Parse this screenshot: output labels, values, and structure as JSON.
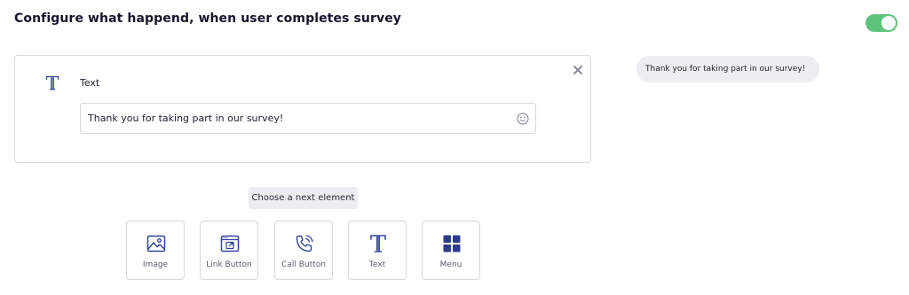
{
  "header": {
    "title": "Configure what happend, when user completes survey",
    "toggle_on": true,
    "toggle_color": "#5ec47d"
  },
  "text_element": {
    "icon": "text-type-icon",
    "label": "Text",
    "input_value": "Thank you for taking part in our survey!",
    "close_icon": "close-icon",
    "emoji_icon": "smiley-icon"
  },
  "preview": {
    "message": "Thank you for taking part in our survey!"
  },
  "next_element": {
    "prompt": "Choose a next element",
    "options": [
      {
        "label": "Image",
        "icon": "image-icon"
      },
      {
        "label": "Link Button",
        "icon": "link-button-icon"
      },
      {
        "label": "Call Button",
        "icon": "phone-icon"
      },
      {
        "label": "Text",
        "icon": "text-type-icon"
      },
      {
        "label": "Menu",
        "icon": "grid-menu-icon"
      }
    ]
  },
  "colors": {
    "accent": "#2c3c8c",
    "icon_outline": "#34459a"
  }
}
